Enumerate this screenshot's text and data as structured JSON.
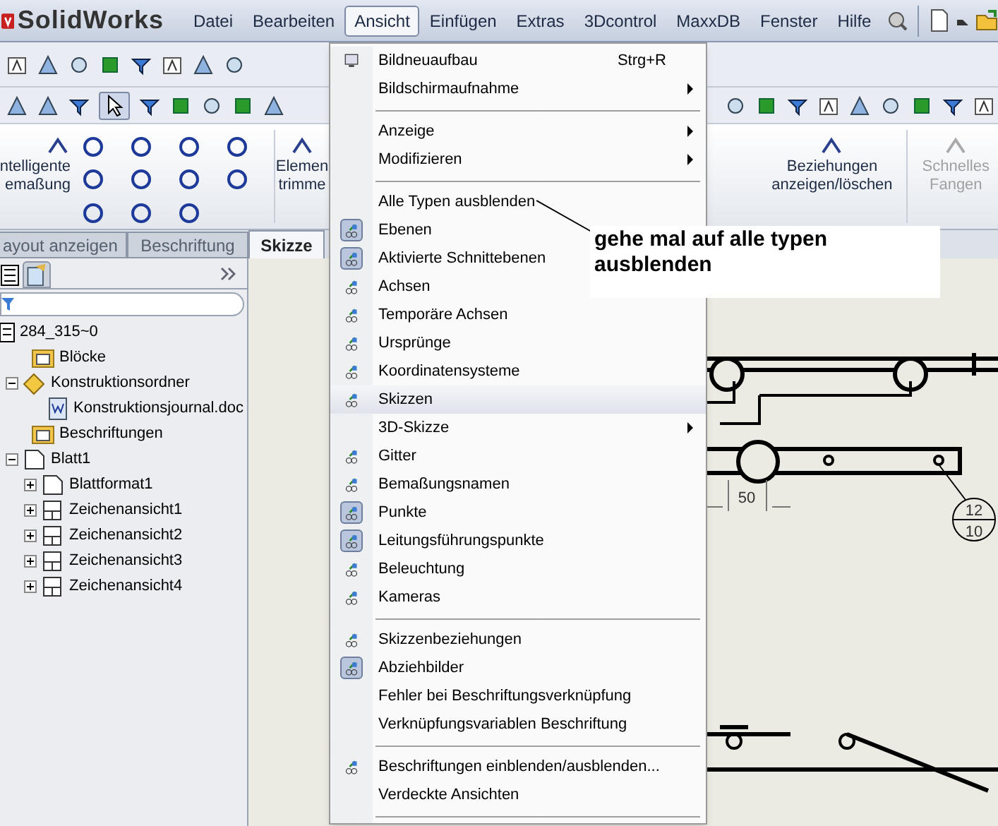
{
  "app": {
    "logo": "SolidWorks"
  },
  "menubar": [
    {
      "label": "Datei",
      "selected": false
    },
    {
      "label": "Bearbeiten",
      "selected": false
    },
    {
      "label": "Ansicht",
      "selected": true
    },
    {
      "label": "Einfügen",
      "selected": false
    },
    {
      "label": "Extras",
      "selected": false
    },
    {
      "label": "3Dcontrol",
      "selected": false
    },
    {
      "label": "MaxxDB",
      "selected": false
    },
    {
      "label": "Fenster",
      "selected": false
    },
    {
      "label": "Hilfe",
      "selected": false
    }
  ],
  "command_manager": {
    "left_buttons": [
      {
        "lines": [
          "ntelligente",
          "emaßung"
        ],
        "disabled": false
      },
      {
        "lines": [
          "Elemen",
          "trimme"
        ],
        "disabled": false
      }
    ],
    "right_buttons": [
      {
        "lines": [
          "Beziehungen",
          "anzeigen/löschen"
        ],
        "disabled": false
      },
      {
        "lines": [
          "Schnelles",
          "Fangen"
        ],
        "disabled": true
      }
    ]
  },
  "tabs": [
    {
      "label": "ayout anzeigen",
      "selected": false
    },
    {
      "label": "Beschriftung",
      "selected": false
    },
    {
      "label": "Skizze",
      "selected": true
    }
  ],
  "tree": {
    "label": "284_315~0",
    "children": [
      {
        "label": "Blöcke"
      },
      {
        "label": "Konstruktionsordner",
        "expanded": true,
        "children": [
          {
            "label": "Konstruktionsjournal.doc"
          }
        ]
      },
      {
        "label": "Beschriftungen"
      },
      {
        "label": "Blatt1",
        "expanded": true,
        "children": [
          {
            "label": "Blattformat1",
            "expanded": false
          },
          {
            "label": "Zeichenansicht1",
            "expanded": false
          },
          {
            "label": "Zeichenansicht2",
            "expanded": false
          },
          {
            "label": "Zeichenansicht3",
            "expanded": false
          },
          {
            "label": "Zeichenansicht4",
            "expanded": false
          }
        ]
      }
    ]
  },
  "view_menu": [
    {
      "kind": "monitor",
      "label": "Bildneuaufbau",
      "shortcut": "Strg+R",
      "submenu": false,
      "checked": false,
      "selected": false
    },
    {
      "kind": "plain",
      "label": "Bildschirmaufnahme",
      "submenu": true,
      "selected": false
    },
    {
      "kind": "separator"
    },
    {
      "kind": "plain",
      "label": "Anzeige",
      "submenu": true,
      "selected": false
    },
    {
      "kind": "plain",
      "label": "Modifizieren",
      "submenu": true,
      "selected": false
    },
    {
      "kind": "separator"
    },
    {
      "kind": "plain",
      "label": "Alle Typen ausblenden",
      "submenu": false,
      "selected": false
    },
    {
      "kind": "view",
      "label": "Ebenen",
      "submenu": false,
      "checked": true,
      "selected": false
    },
    {
      "kind": "view",
      "label": "Aktivierte Schnittebenen",
      "submenu": false,
      "checked": true,
      "selected": false
    },
    {
      "kind": "view",
      "label": "Achsen",
      "submenu": false,
      "checked": false,
      "selected": false
    },
    {
      "kind": "view",
      "label": "Temporäre Achsen",
      "submenu": false,
      "checked": false,
      "selected": false
    },
    {
      "kind": "view",
      "label": "Ursprünge",
      "submenu": false,
      "checked": false,
      "selected": false
    },
    {
      "kind": "view",
      "label": "Koordinatensysteme",
      "submenu": false,
      "checked": false,
      "selected": false
    },
    {
      "kind": "view",
      "label": "Skizzen",
      "submenu": false,
      "checked": false,
      "selected": true
    },
    {
      "kind": "plain",
      "label": "3D-Skizze",
      "submenu": true,
      "selected": false
    },
    {
      "kind": "view",
      "label": "Gitter",
      "submenu": false,
      "checked": false,
      "selected": false
    },
    {
      "kind": "view",
      "label": "Bemaßungsnamen",
      "submenu": false,
      "checked": false,
      "selected": false
    },
    {
      "kind": "view",
      "label": "Punkte",
      "submenu": false,
      "checked": true,
      "selected": false
    },
    {
      "kind": "view",
      "label": "Leitungsführungspunkte",
      "submenu": false,
      "checked": true,
      "selected": false
    },
    {
      "kind": "view",
      "label": "Beleuchtung",
      "submenu": false,
      "checked": false,
      "selected": false
    },
    {
      "kind": "view",
      "label": "Kameras",
      "submenu": false,
      "checked": false,
      "selected": false
    },
    {
      "kind": "separator"
    },
    {
      "kind": "view",
      "label": "Skizzenbeziehungen",
      "submenu": false,
      "checked": false,
      "selected": false
    },
    {
      "kind": "view",
      "label": "Abziehbilder",
      "submenu": false,
      "checked": true,
      "selected": false
    },
    {
      "kind": "plain",
      "label": "Fehler bei Beschriftungsverknüpfung",
      "submenu": false,
      "selected": false
    },
    {
      "kind": "plain",
      "label": "Verknüpfungsvariablen Beschriftung",
      "submenu": false,
      "selected": false
    },
    {
      "kind": "separator"
    },
    {
      "kind": "view",
      "label": "Beschriftungen einblenden/ausblenden...",
      "submenu": false,
      "checked": false,
      "selected": false
    },
    {
      "kind": "plain",
      "label": "Verdeckte Ansichten",
      "submenu": false,
      "selected": false
    },
    {
      "kind": "separator"
    }
  ],
  "callout": {
    "text": "gehe mal auf alle typen ausblenden"
  },
  "drawing": {
    "dimension": "50",
    "balloon": [
      "12",
      "10"
    ]
  }
}
